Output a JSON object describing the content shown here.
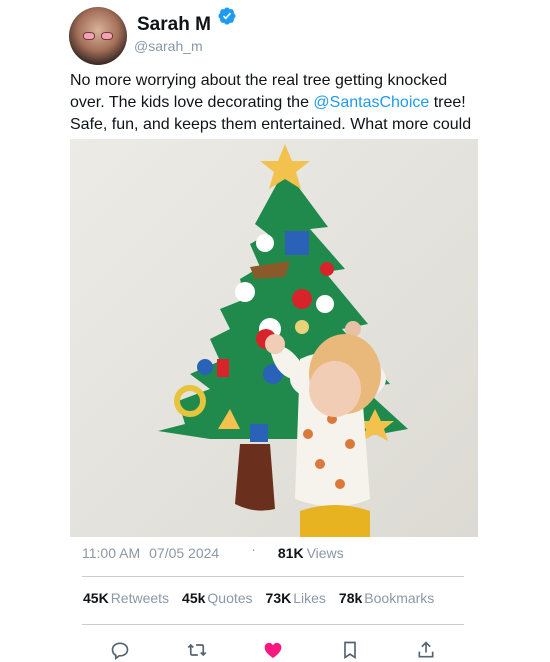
{
  "author": {
    "name": "Sarah M",
    "handle": "@sarah_m"
  },
  "tweet": {
    "text_before": "No more worrying about the real tree getting knocked over. The kids love decorating the ",
    "mention": "@SantasChoice",
    "text_after": " tree! Safe, fun, and keeps them entertained. What more could you want?"
  },
  "meta": {
    "time": "11:00 AM",
    "date": "07/05 2024",
    "separator": "·",
    "views_count": "81K",
    "views_label": "Views"
  },
  "stats": {
    "retweets_count": "45K",
    "retweets_label": "Retweets",
    "quotes_count": "45k",
    "quotes_label": "Quotes",
    "likes_count": "73K",
    "likes_label": "Likes",
    "bookmarks_count": "78k",
    "bookmarks_label": "Bookmarks"
  },
  "icons": {
    "reply": "reply-icon",
    "retweet": "retweet-icon",
    "like": "heart-icon",
    "bookmark": "bookmark-icon",
    "share": "share-icon"
  },
  "colors": {
    "accent": "#1d9bf0",
    "like_active": "#f91880",
    "muted": "#8b98a5"
  }
}
